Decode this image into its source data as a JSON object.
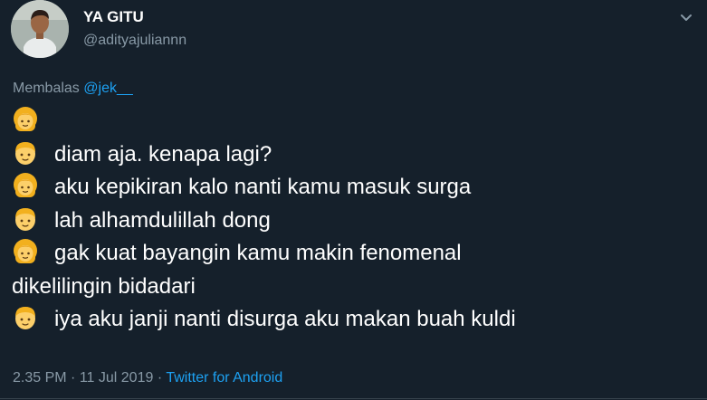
{
  "author": {
    "display_name": "YA GITU",
    "username": "@adityajuliannn"
  },
  "reply": {
    "prefix": "Membalas",
    "mention": "@jek__"
  },
  "tweet": {
    "lines": [
      {
        "emoji": "girl-emoji",
        "text": ""
      },
      {
        "emoji": "boy-emoji",
        "text": "diam aja. kenapa lagi?"
      },
      {
        "emoji": "girl-emoji",
        "text": "aku kepikiran kalo nanti kamu masuk surga"
      },
      {
        "emoji": "boy-emoji",
        "text": "lah alhamdulillah dong"
      },
      {
        "emoji": "girl-emoji",
        "text": "gak kuat bayangin kamu makin fenomenal"
      },
      {
        "emoji": "",
        "text": "dikelilingin bidadari"
      },
      {
        "emoji": "boy-emoji",
        "text": "iya aku janji nanti disurga aku makan buah kuldi"
      }
    ]
  },
  "meta": {
    "time": "2.35 PM",
    "separator_1": "·",
    "date": "11 Jul 2019",
    "separator_2": "·",
    "source": "Twitter for Android"
  },
  "colors": {
    "background": "#15202b",
    "text_primary": "#ffffff",
    "text_secondary": "#8899a6",
    "accent": "#1da1f2"
  }
}
